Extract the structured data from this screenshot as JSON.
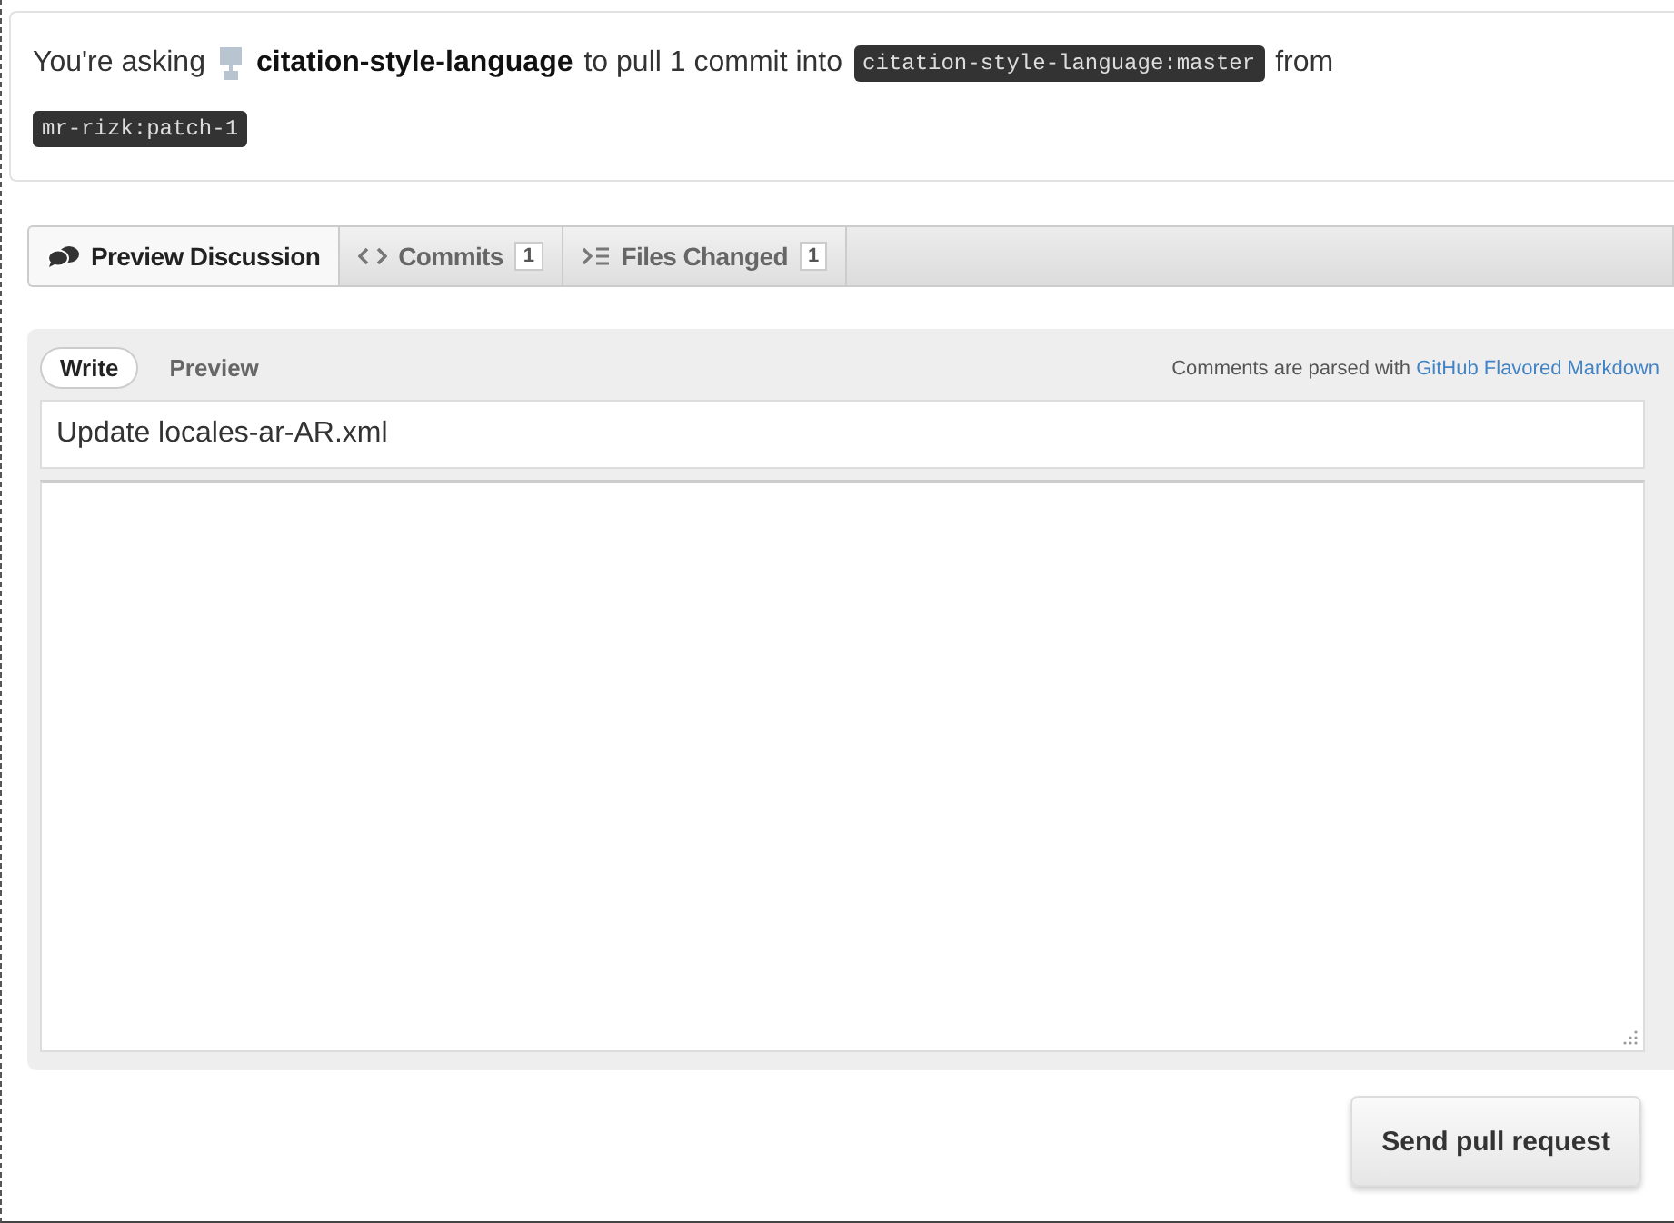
{
  "request": {
    "prefix": "You're asking",
    "repo": "citation-style-language",
    "middle": "to pull 1 commit into",
    "base_branch": "citation-style-language:master",
    "joiner": "from",
    "head_branch": "mr-rizk:patch-1"
  },
  "tabs": [
    {
      "kind": "discussion",
      "label": "Preview Discussion",
      "selected": true
    },
    {
      "kind": "commits",
      "label": "Commits",
      "count": "1",
      "selected": false
    },
    {
      "kind": "files",
      "label": "Files Changed",
      "count": "1",
      "selected": false
    }
  ],
  "editor": {
    "modes": [
      {
        "label": "Write",
        "selected": true
      },
      {
        "label": "Preview",
        "selected": false
      }
    ],
    "hint": "Comments are parsed with",
    "hint_link": "GitHub Flavored Markdown",
    "title_value": "Update locales-ar-AR.xml"
  },
  "submit_button": "Send pull request"
}
